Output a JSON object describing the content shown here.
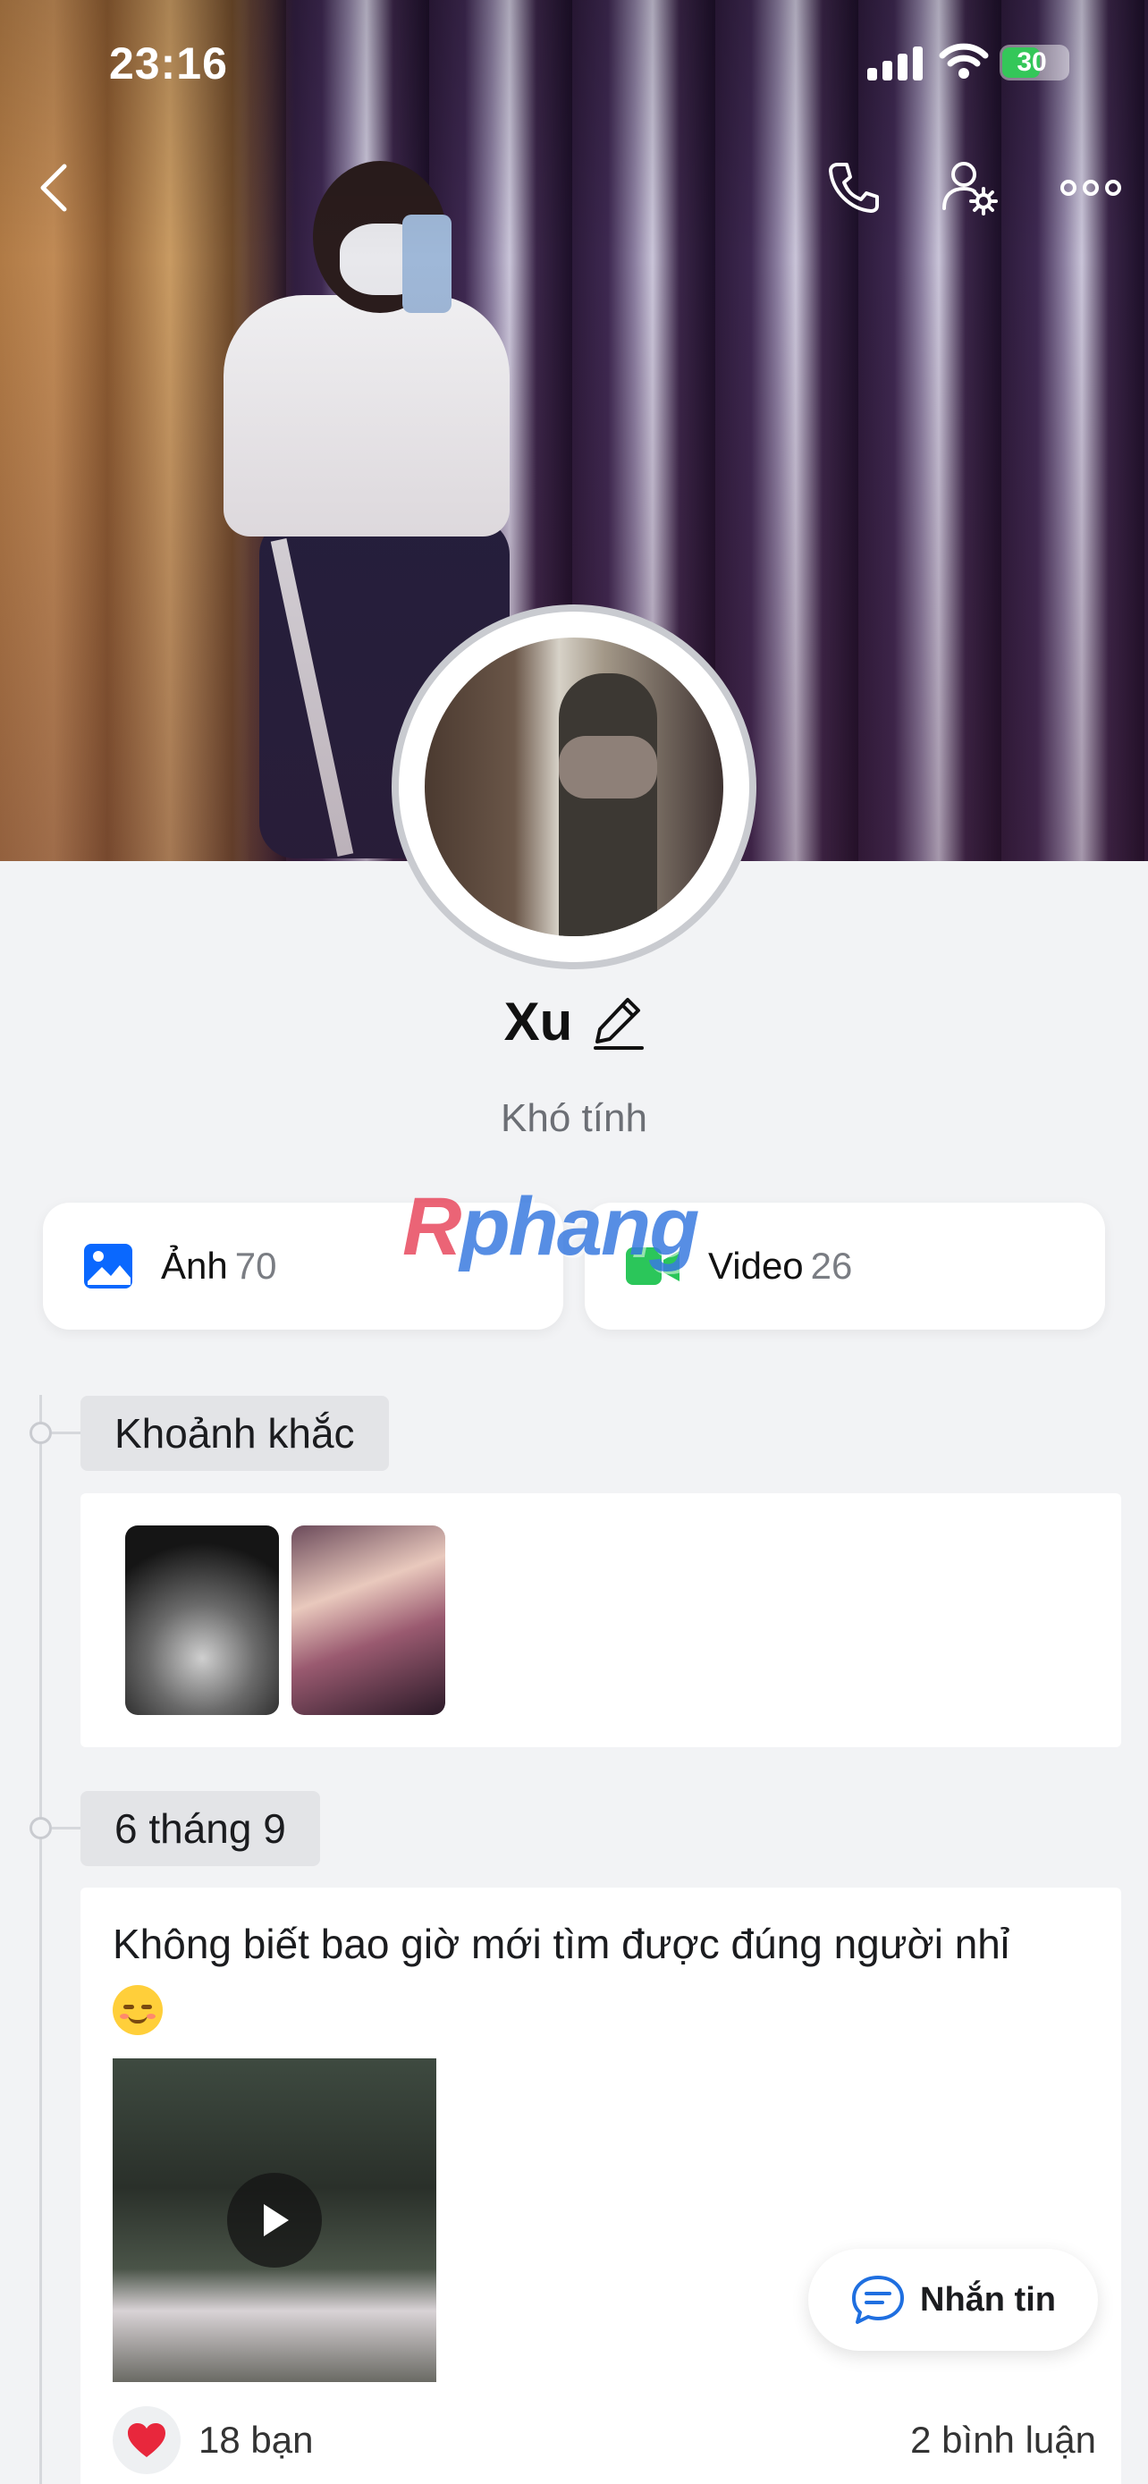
{
  "status_bar": {
    "time": "23:16",
    "battery": "30"
  },
  "nav": {
    "back_icon": "chevron-left-icon",
    "call_icon": "phone-icon",
    "settings_icon": "user-settings-icon",
    "more_icon": "more-horizontal-icon"
  },
  "profile": {
    "name": "Xu",
    "bio": "Khó tính"
  },
  "media": {
    "photo_label": "Ảnh",
    "photo_count": "70",
    "video_label": "Video",
    "video_count": "26"
  },
  "watermark": {
    "part1": "R",
    "part2": "phang"
  },
  "timeline": {
    "moments_label": "Khoảnh khắc",
    "post_date": "6 tháng 9",
    "post_text": "Không biết bao giờ mới tìm được đúng người nhỉ",
    "likes": "18 bạn",
    "comments": "2 bình luận"
  },
  "message_button": {
    "label": "Nhắn tin"
  },
  "colors": {
    "accent_blue": "#0a68fe",
    "video_green": "#2bc65a",
    "heart_red": "#e8273c",
    "background": "#f2f3f5"
  }
}
